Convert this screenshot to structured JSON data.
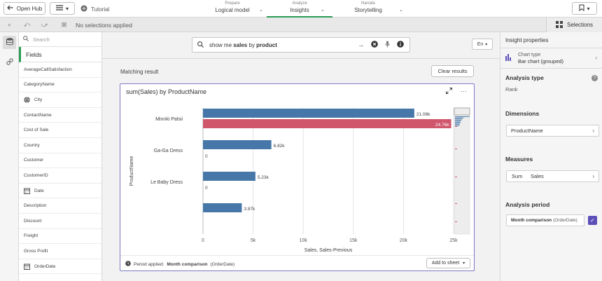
{
  "topbar": {
    "open_hub": "Open Hub",
    "app_name": "Tutorial",
    "nav": [
      {
        "small": "Prepare",
        "big": "Logical model"
      },
      {
        "small": "Analyze",
        "big": "Insights"
      },
      {
        "small": "Narrate",
        "big": "Storytelling"
      }
    ]
  },
  "selection_bar": {
    "status": "No selections applied",
    "selections_label": "Selections"
  },
  "fields_panel": {
    "search_placeholder": "Search",
    "header": "Fields",
    "items": [
      {
        "label": "AverageCallSatisfaction",
        "icon": ""
      },
      {
        "label": "CategoryName",
        "icon": ""
      },
      {
        "label": "City",
        "icon": "globe-icon"
      },
      {
        "label": "ContactName",
        "icon": ""
      },
      {
        "label": "Cost of Sale",
        "icon": ""
      },
      {
        "label": "Country",
        "icon": ""
      },
      {
        "label": "Customer",
        "icon": ""
      },
      {
        "label": "CustomerID",
        "icon": ""
      },
      {
        "label": "Date",
        "icon": "calendar-icon"
      },
      {
        "label": "Description",
        "icon": ""
      },
      {
        "label": "Discount",
        "icon": ""
      },
      {
        "label": "Freight",
        "icon": ""
      },
      {
        "label": "Gross Profit",
        "icon": ""
      },
      {
        "label": "OrderDate",
        "icon": "calendar-icon"
      }
    ]
  },
  "search": {
    "query_pre": "show me ",
    "query_bold": "sales",
    "query_mid": " by ",
    "query_bold2": "product",
    "language": "En"
  },
  "results": {
    "matching_label": "Matching result",
    "clear_label": "Clear results",
    "card_title": "sum(Sales) by ProductName",
    "period_prefix": "Period applied:",
    "period_value": "Month comparison",
    "period_field": "(OrderDate)",
    "add_to_sheet": "Add to sheet"
  },
  "chart_data": {
    "type": "bar",
    "orientation": "horizontal",
    "categories": [
      "Minnki Palsii",
      "Ga-Ga Dress",
      "Le Baby Dress",
      ""
    ],
    "series": [
      {
        "name": "",
        "color": "#4677a8",
        "values": [
          21080,
          6820,
          5230,
          3870
        ],
        "labels": [
          "21.08k",
          "6.82k",
          "5.23k",
          "3.87k"
        ]
      },
      {
        "name": "",
        "color": "#d0566c",
        "values": [
          24760,
          0,
          0,
          null
        ],
        "labels": [
          "24.76k",
          "0",
          "0",
          ""
        ]
      }
    ],
    "xlabel": "Sales, Sales-Previous",
    "ylabel": "ProductName",
    "xlim": [
      0,
      25000
    ],
    "xticks": [
      0,
      5000,
      10000,
      15000,
      20000,
      25000
    ],
    "xtick_labels": [
      "0",
      "5k",
      "10k",
      "15k",
      "20k",
      "25k"
    ],
    "grid": true
  },
  "insight_panel": {
    "header": "Insight properties",
    "chart_type_label": "Chart type",
    "chart_type_value": "Bar chart (grouped)",
    "analysis_type_label": "Analysis type",
    "analysis_type_value": "Rank",
    "dimensions_label": "Dimensions",
    "dimension_value": "ProductName",
    "measures_label": "Measures",
    "measure_agg": "Sum",
    "measure_field": "Sales",
    "period_label": "Analysis period",
    "period_value": "Month comparison",
    "period_field": "(OrderDate)"
  }
}
